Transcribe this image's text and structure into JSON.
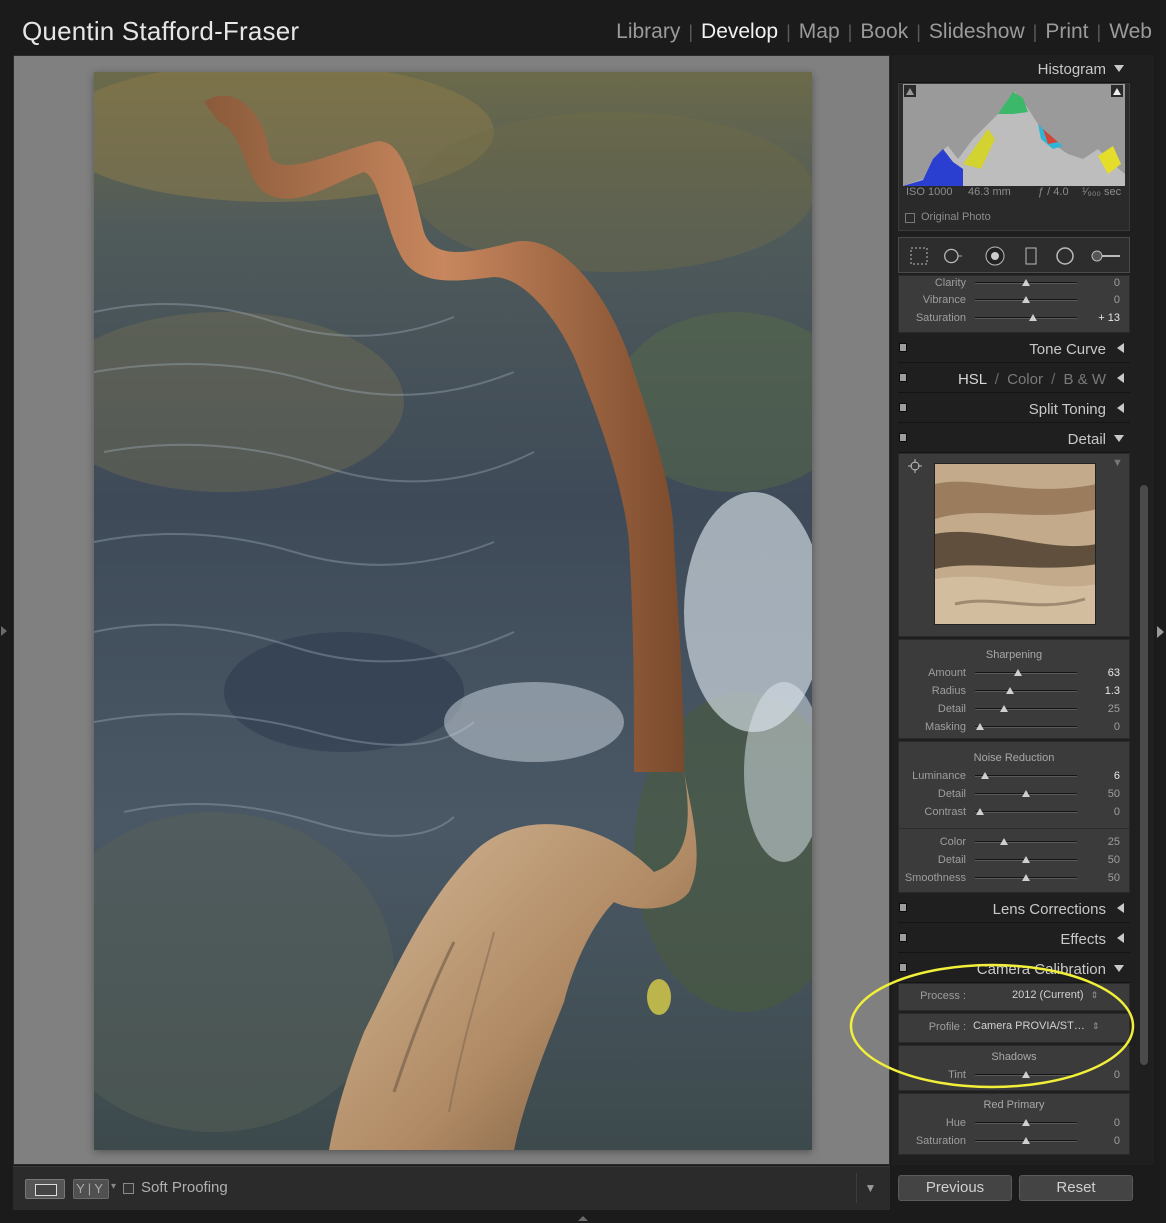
{
  "app": {
    "identity_plate": "Quentin Stafford-Fraser",
    "modules": [
      {
        "label": "Library",
        "active": false
      },
      {
        "label": "Develop",
        "active": true
      },
      {
        "label": "Map",
        "active": false
      },
      {
        "label": "Book",
        "active": false
      },
      {
        "label": "Slideshow",
        "active": false
      },
      {
        "label": "Print",
        "active": false
      },
      {
        "label": "Web",
        "active": false
      }
    ]
  },
  "histogram": {
    "title": "Histogram",
    "iso": "ISO 1000",
    "focal_length": "46.3 mm",
    "aperture": "ƒ / 4.0",
    "shutter": "¹⁄₉₀₀ sec",
    "original_photo_label": "Original Photo"
  },
  "basic_partial": {
    "clarity_label": "Clarity",
    "clarity_value": "0",
    "clarity_pos": 0.5,
    "vibrance_label": "Vibrance",
    "vibrance_value": "0",
    "vibrance_pos": 0.5,
    "saturation_label": "Saturation",
    "saturation_value": "+ 13",
    "saturation_pos": 0.565
  },
  "panels": {
    "tone_curve": "Tone Curve",
    "hsl": "HSL",
    "hsl_sep": "/",
    "color": "Color",
    "bw": "B & W",
    "split_toning": "Split Toning",
    "detail": "Detail",
    "lens_corrections": "Lens Corrections",
    "effects": "Effects",
    "camera_calibration": "Camera Calibration"
  },
  "detail": {
    "sharpening_title": "Sharpening",
    "amount_label": "Amount",
    "amount_value": "63",
    "amount_pos": 0.42,
    "radius_label": "Radius",
    "radius_value": "1.3",
    "radius_pos": 0.34,
    "detail_label": "Detail",
    "detail_value": "25",
    "detail_pos": 0.28,
    "masking_label": "Masking",
    "masking_value": "0",
    "masking_pos": 0.05,
    "noise_title": "Noise Reduction",
    "luminance_label": "Luminance",
    "luminance_value": "6",
    "luminance_pos": 0.1,
    "nr_detail_label": "Detail",
    "nr_detail_value": "50",
    "nr_detail_pos": 0.5,
    "contrast_label": "Contrast",
    "contrast_value": "0",
    "contrast_pos": 0.05,
    "color_label": "Color",
    "color_value": "25",
    "color_pos": 0.28,
    "color_detail_label": "Detail",
    "color_detail_value": "50",
    "color_detail_pos": 0.5,
    "smoothness_label": "Smoothness",
    "smoothness_value": "50",
    "smoothness_pos": 0.5
  },
  "calibration": {
    "process_label": "Process :",
    "process_value": "2012 (Current)",
    "profile_label": "Profile :",
    "profile_value": "Camera PROVIA/ST…",
    "shadows_title": "Shadows",
    "tint_label": "Tint",
    "tint_value": "0",
    "tint_pos": 0.5,
    "red_primary_title": "Red Primary",
    "hue_label": "Hue",
    "hue_value": "0",
    "hue_pos": 0.5,
    "sat_label": "Saturation",
    "sat_value": "0",
    "sat_pos": 0.5
  },
  "toolbar": {
    "yy_label": "Y|Y",
    "soft_proofing_label": "Soft Proofing"
  },
  "buttons": {
    "previous": "Previous",
    "reset": "Reset"
  },
  "colors": {
    "annotation_ellipse": "#f2ef3a",
    "accent_text": "#f2f2f2"
  }
}
